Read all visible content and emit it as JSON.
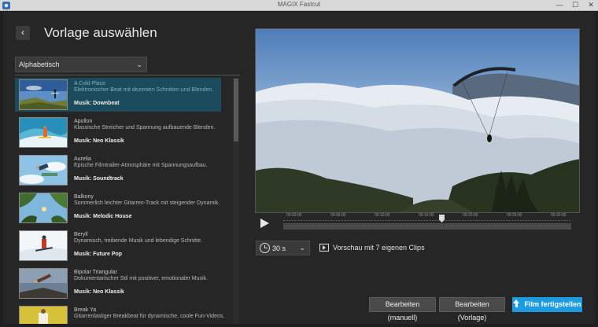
{
  "window": {
    "title": "MAGIX Fastcut",
    "controls": {
      "minimize": "—",
      "maximize": "☐",
      "close": "✕"
    }
  },
  "header": {
    "back_icon": "chevron-left-icon",
    "back_glyph": "‹",
    "title": "Vorlage auswählen"
  },
  "sort": {
    "selected": "Alphabetisch",
    "chevron": "⌄"
  },
  "templates": [
    {
      "name": "A Cold Place",
      "description": "Elektronischer Beat mit dezenten Schnitten und Blenden.",
      "music": "Musik: Downbeat",
      "selected": true,
      "thumb": "mountain-sky"
    },
    {
      "name": "Apollon",
      "description": "Klassische Streicher und Spannung aufbauende Blenden.",
      "music": "Musik: Neo Klassik",
      "selected": false,
      "thumb": "surfer-wave"
    },
    {
      "name": "Aurelia",
      "description": "Epische Filmtrailer-Atmosphäre mit Spannungsaufbau.",
      "music": "Musik: Soundtrack",
      "selected": false,
      "thumb": "skydiver"
    },
    {
      "name": "Balkony",
      "description": "Sommerlich leichter Gitarren-Track mit steigender Dynamik.",
      "music": "Musik: Melodic House",
      "selected": false,
      "thumb": "tree-canopy"
    },
    {
      "name": "Beryll",
      "description": "Dynamisch, treibende Musik und lebendige Schnitte.",
      "music": "Musik: Future Pop",
      "selected": false,
      "thumb": "snow-skier"
    },
    {
      "name": "Bipolar Triangular",
      "description": "Dokumentarischer Stil mit positiver, emotionaler Musik.",
      "music": "Musik: Neo Klassik",
      "selected": false,
      "thumb": "jump-sky"
    },
    {
      "name": "Break Ya",
      "description": "Gitarrenlastiger Breakbeat für dynamische, coole Fun-Videos.",
      "music": "",
      "selected": false,
      "thumb": "yellow-scene"
    }
  ],
  "timeline": {
    "ticks": [
      "00:00:00",
      "00:05:00",
      "00:10:00",
      "00:15:00",
      "00:20:00",
      "00:25:00",
      "00:30:00"
    ],
    "position": 0.55
  },
  "duration": {
    "value": "30 s",
    "chevron": "⌄"
  },
  "preview_info": "Vorschau mit 7 eigenen Clips",
  "buttons": {
    "edit_manual": "Bearbeiten (manuell)",
    "edit_template": "Bearbeiten (Vorlage)",
    "finish": "Film fertigstellen"
  },
  "colors": {
    "accent": "#1e9be0",
    "selected_row": "#1b4b5c"
  }
}
